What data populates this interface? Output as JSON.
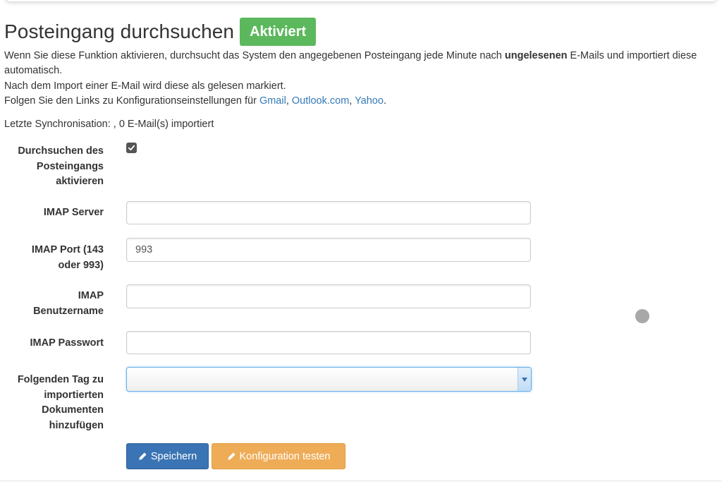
{
  "header": {
    "title": "Posteingang durchsuchen",
    "status_badge": "Aktiviert"
  },
  "description": {
    "line1_pre": "Wenn Sie diese Funktion aktivieren, durchsucht das System den angegebenen Posteingang jede Minute nach ",
    "line1_bold": "ungelesenen",
    "line1_post": " E-Mails und importiert diese automatisch.",
    "line2": "Nach dem Import einer E-Mail wird diese als gelesen markiert.",
    "line3_pre": "Folgen Sie den Links zu Konfigurationseinstellungen für ",
    "links": [
      "Gmail",
      "Outlook.com",
      "Yahoo"
    ],
    "sep": ", ",
    "line3_end": "."
  },
  "sync_status": "Letzte Synchronisation: , 0 E-Mail(s) importiert",
  "form": {
    "enable_label": "Durchsuchen des Posteingangs aktivieren",
    "enable_checked": true,
    "imap_server_label": "IMAP Server",
    "imap_server_value": "",
    "imap_port_label": "IMAP Port (143 oder 993)",
    "imap_port_value": "993",
    "imap_user_label": "IMAP Benutzername",
    "imap_user_value": "",
    "imap_password_label": "IMAP Passwort",
    "imap_password_value": "",
    "tag_label": "Folgenden Tag zu importierten Dokumenten hinzufügen",
    "tag_value": ""
  },
  "buttons": {
    "save_label": "Speichern",
    "test_label": "Konfiguration testen"
  },
  "colors": {
    "badge": "#5cb85c",
    "link": "#337ab7",
    "save_button": "#3a74b4",
    "test_button": "#eeac57"
  }
}
